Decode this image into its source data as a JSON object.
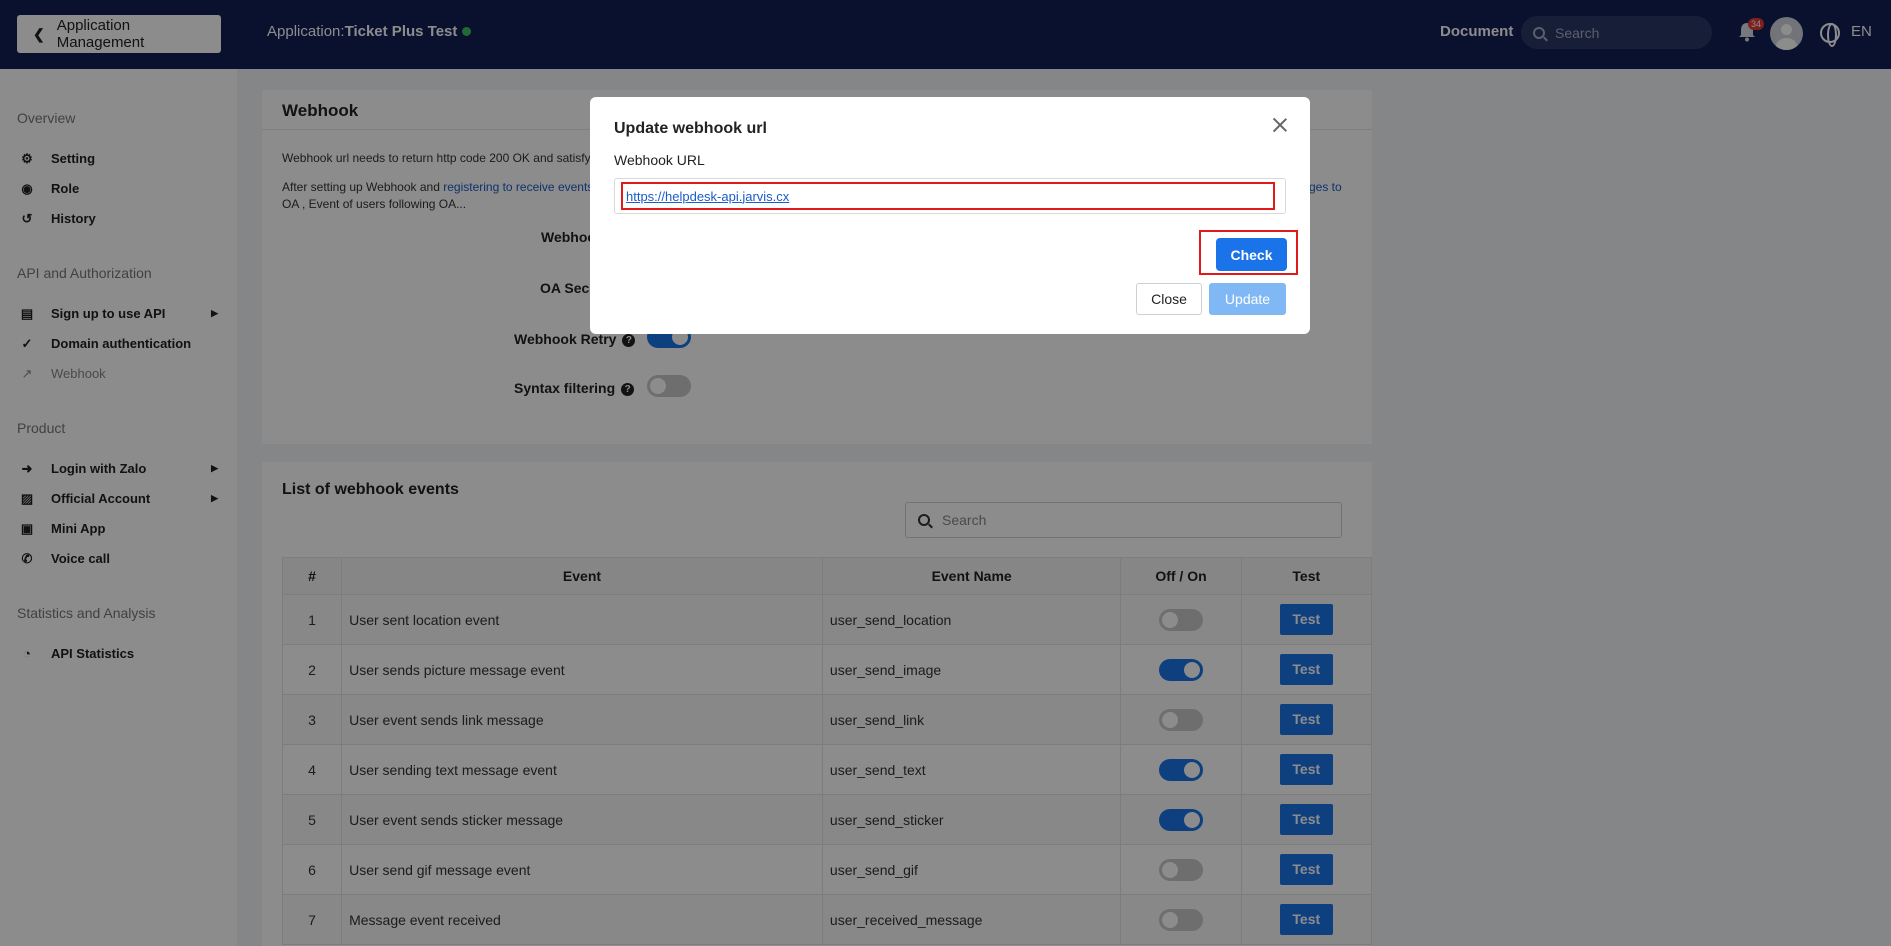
{
  "topbar": {
    "back_label": "Application Management",
    "app_prefix": "Application:",
    "app_name": "Ticket Plus Test",
    "document_label": "Document",
    "search_placeholder": "Search",
    "notification_count": "34",
    "language": "EN"
  },
  "sidebar": {
    "sections": [
      {
        "title": "Overview",
        "items": [
          {
            "label": "Setting",
            "icon": "gear-icon"
          },
          {
            "label": "Role",
            "icon": "user-circle-icon"
          },
          {
            "label": "History",
            "icon": "history-icon"
          }
        ]
      },
      {
        "title": "API and Authorization",
        "items": [
          {
            "label": "Sign up to use API",
            "icon": "inbox-icon"
          },
          {
            "label": "Domain authentication",
            "icon": "check-circle-icon"
          },
          {
            "label": "Webhook",
            "icon": "external-link-icon"
          }
        ]
      },
      {
        "title": "Product",
        "items": [
          {
            "label": "Login with Zalo",
            "icon": "login-icon"
          },
          {
            "label": "Official Account",
            "icon": "id-card-icon"
          },
          {
            "label": "Mini App",
            "icon": "cube-icon"
          },
          {
            "label": "Voice call",
            "icon": "phone-icon"
          }
        ]
      },
      {
        "title": "Statistics and Analysis",
        "items": [
          {
            "label": "API Statistics",
            "icon": "gauge-icon"
          }
        ]
      }
    ]
  },
  "webhook_card": {
    "title": "Webhook",
    "desc1": "Webhook url needs to return http code 200 OK and satisfy p",
    "desc2_prefix": "After setting up Webhook and ",
    "desc2_link": "registering to receive events",
    "desc2_line2": "OA , Event of users following OA...",
    "desc2_right": "ges to",
    "webhook_label": "Webhoo",
    "oa_secret_label": "OA Secr",
    "retry_label": "Webhook Retry",
    "syntax_label": "Syntax filtering",
    "retry_on": true,
    "syntax_on": false
  },
  "events_card": {
    "title": "List of webhook events",
    "search_placeholder": "Search",
    "columns": [
      "#",
      "Event",
      "Event Name",
      "Off / On",
      "Test"
    ],
    "test_label": "Test",
    "rows": [
      {
        "num": "1",
        "event": "User sent location event",
        "name": "user_send_location",
        "on": false
      },
      {
        "num": "2",
        "event": "User sends picture message event",
        "name": "user_send_image",
        "on": true
      },
      {
        "num": "3",
        "event": "User event sends link message",
        "name": "user_send_link",
        "on": false
      },
      {
        "num": "4",
        "event": "User sending text message event",
        "name": "user_send_text",
        "on": true
      },
      {
        "num": "5",
        "event": "User event sends sticker message",
        "name": "user_send_sticker",
        "on": true
      },
      {
        "num": "6",
        "event": "User send gif message event",
        "name": "user_send_gif",
        "on": false
      },
      {
        "num": "7",
        "event": "Message event received",
        "name": "user_received_message",
        "on": false
      }
    ]
  },
  "modal": {
    "title": "Update webhook url",
    "field_label": "Webhook URL",
    "url_value": "https://helpdesk-api.jarvis.cx",
    "check_label": "Check",
    "close_label": "Close",
    "update_label": "Update"
  }
}
